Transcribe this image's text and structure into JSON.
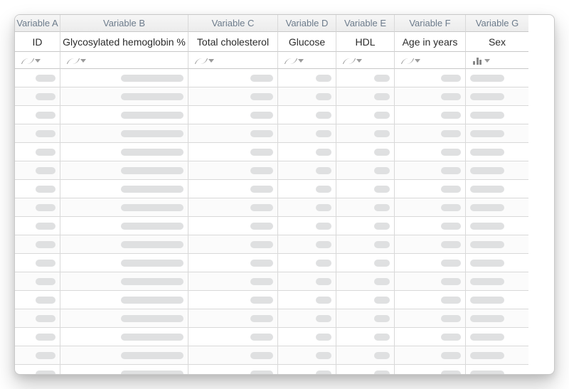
{
  "columns": [
    {
      "var": "Variable A",
      "label": "ID",
      "type": "numeric",
      "phWidth": 28,
      "phAlign": "right"
    },
    {
      "var": "Variable B",
      "label": "Glycosylated hemoglobin %",
      "type": "numeric",
      "phWidth": 88,
      "phAlign": "right"
    },
    {
      "var": "Variable C",
      "label": "Total cholesterol",
      "type": "numeric",
      "phWidth": 32,
      "phAlign": "right"
    },
    {
      "var": "Variable D",
      "label": "Glucose",
      "type": "numeric",
      "phWidth": 22,
      "phAlign": "right"
    },
    {
      "var": "Variable E",
      "label": "HDL",
      "type": "numeric",
      "phWidth": 22,
      "phAlign": "right"
    },
    {
      "var": "Variable F",
      "label": "Age in years",
      "type": "numeric",
      "phWidth": 28,
      "phAlign": "right"
    },
    {
      "var": "Variable G",
      "label": "Sex",
      "type": "category",
      "phWidth": 48,
      "phAlign": "left"
    }
  ],
  "rowCount": 17
}
